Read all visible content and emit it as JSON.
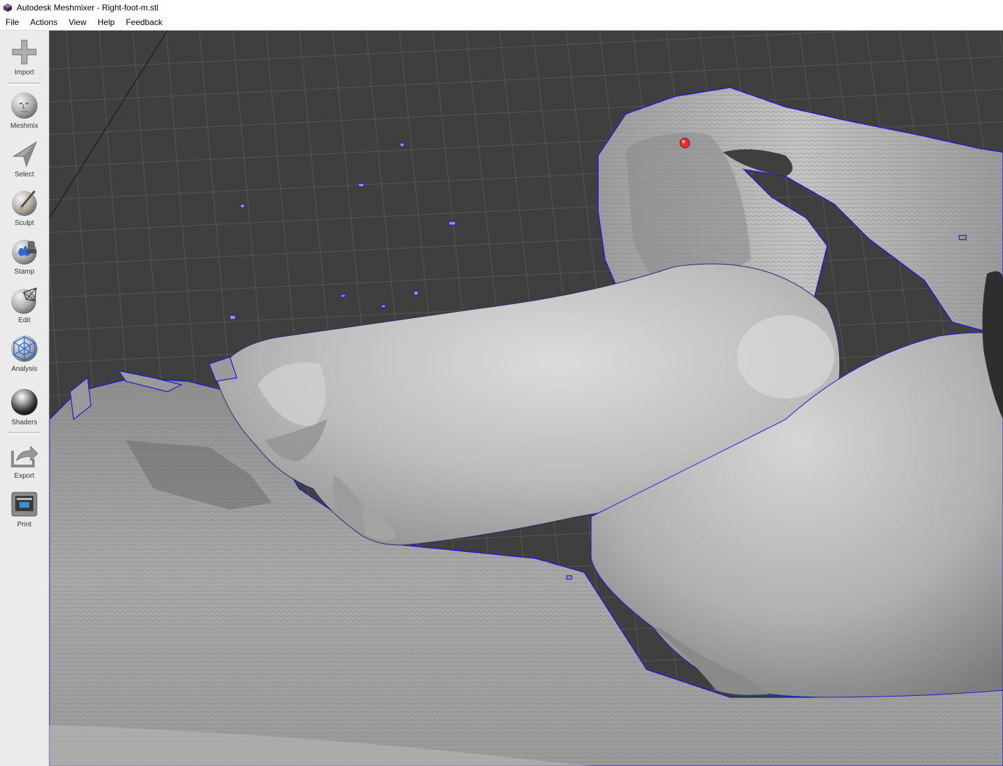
{
  "window": {
    "title": "Autodesk Meshmixer - Right-foot-m.stl",
    "app_icon": "meshmixer-logo-icon"
  },
  "menu": {
    "items": [
      "File",
      "Actions",
      "View",
      "Help",
      "Feedback"
    ]
  },
  "sidebar": {
    "tools": [
      {
        "label": "Import",
        "icon": "plus-icon"
      },
      {
        "label": "Meshmix",
        "icon": "meshmix-face-sphere-icon"
      },
      {
        "label": "Select",
        "icon": "cursor-arrow-icon"
      },
      {
        "label": "Sculpt",
        "icon": "sculpt-brush-icon"
      },
      {
        "label": "Stamp",
        "icon": "stamp-icon"
      },
      {
        "label": "Edit",
        "icon": "edit-sphere-icon"
      },
      {
        "label": "Analysis",
        "icon": "analysis-mesh-icon"
      },
      {
        "label": "Shaders",
        "icon": "shader-sphere-icon"
      },
      {
        "label": "Export",
        "icon": "export-icon"
      },
      {
        "label": "Print",
        "icon": "printer-icon"
      }
    ]
  },
  "viewport": {
    "background": "#3f3f3f",
    "grid_color": "#575757",
    "mesh_color": "#b4b4b4",
    "boundary_color": "#1a1ad6",
    "pivot_color": "#e03030",
    "content": "3D scanned right foot mesh with ground scan surface"
  }
}
